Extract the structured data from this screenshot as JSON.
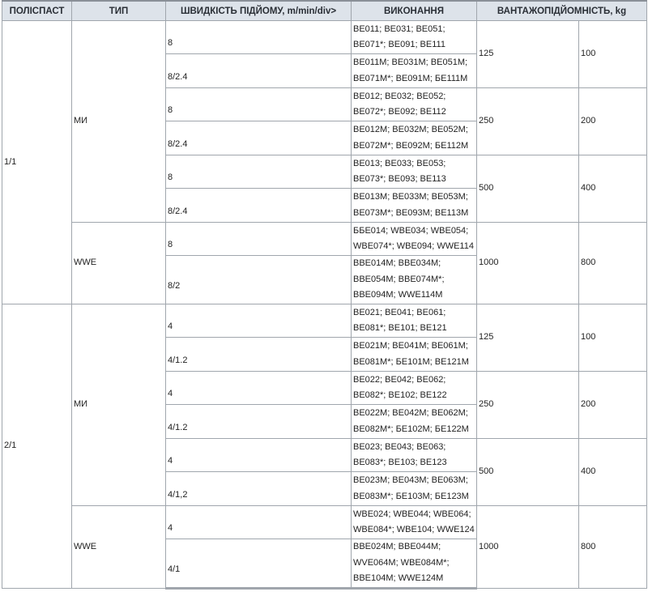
{
  "headers": {
    "polispast": "ПОЛІСПАСТ",
    "typ": "ТИП",
    "speed": "ШВИДКІСТЬ ПІДЙОМУ, m/min/div>",
    "models": "ВИКОНАННЯ",
    "capacity": "ВАНТАЖОПІДЙОМНІСТЬ, kg"
  },
  "groups": [
    {
      "polispast": "1/1",
      "types": [
        {
          "name": "МИ",
          "capacity_rows": [
            {
              "cap1": "125",
              "cap2": "100",
              "rows": [
                {
                  "speed": "8",
                  "models": "BE011; BE031; BE051; BE071*; BE091; BE111"
                },
                {
                  "speed": "8/2.4",
                  "models": "BE011M; BE031M; BE051M; BE071M*; BE091M; БЕ111M"
                }
              ]
            },
            {
              "cap1": "250",
              "cap2": "200",
              "rows": [
                {
                  "speed": "8",
                  "models": "BE012; BE032; BE052; BE072*; BE092; BE112"
                },
                {
                  "speed": "8/2.4",
                  "models": "BE012M; BE032M; BE052M; BE072M*; BE092M; БЕ112M"
                }
              ]
            },
            {
              "cap1": "500",
              "cap2": "400",
              "rows": [
                {
                  "speed": "8",
                  "models": "BE013; BE033; BE053; BE073*; BE093; BE113"
                },
                {
                  "speed": "8/2.4",
                  "models": "BE013M; BE033M; BE053M; BE073M*; BE093M; BE113M"
                }
              ]
            }
          ]
        },
        {
          "name": "WWE",
          "capacity_rows": [
            {
              "cap1": "1000",
              "cap2": "800",
              "rows": [
                {
                  "speed": "8",
                  "models": "ББЕ014; WBE034; WBE054; WBE074*; WBE094; WWE114"
                },
                {
                  "speed": "8/2",
                  "models": "BBE014M; BBE034M; BBE054M; BBE074M*; BBE094M; WWE114M"
                }
              ]
            }
          ]
        }
      ]
    },
    {
      "polispast": "2/1",
      "types": [
        {
          "name": "МИ",
          "capacity_rows": [
            {
              "cap1": "125",
              "cap2": "100",
              "rows": [
                {
                  "speed": "4",
                  "models": "BE021; BE041; BE061; BE081*; BE101; BE121"
                },
                {
                  "speed": "4/1.2",
                  "models": "BE021M; BE041M; BE061M; BE081M*; БЕ101M; BE121M"
                }
              ]
            },
            {
              "cap1": "250",
              "cap2": "200",
              "rows": [
                {
                  "speed": "4",
                  "models": "BE022; BE042; BE062; BE082*; BE102; BE122"
                },
                {
                  "speed": "4/1.2",
                  "models": "BE022M; BE042M; BE062M; BE082M*; БЕ102M; БЕ122M"
                }
              ]
            },
            {
              "cap1": "500",
              "cap2": "400",
              "rows": [
                {
                  "speed": "4",
                  "models": "BE023; BE043; BE063; BE083*; BE103; BE123"
                },
                {
                  "speed": "4/1,2",
                  "models": "BE023M; BE043M; BE063M; BE083M*; БЕ103M; БЕ123M"
                }
              ]
            }
          ]
        },
        {
          "name": "WWE",
          "capacity_rows": [
            {
              "cap1": "1000",
              "cap2": "800",
              "rows": [
                {
                  "speed": "4",
                  "models": "WBE024; WBE044; WBE064; WBE084*; WBE104; WWE124"
                },
                {
                  "speed": "4/1",
                  "models": "BBE024M; BBE044M; WVE064M; WBE084M*; BBE104M; WWE124M"
                }
              ]
            }
          ]
        }
      ]
    }
  ]
}
